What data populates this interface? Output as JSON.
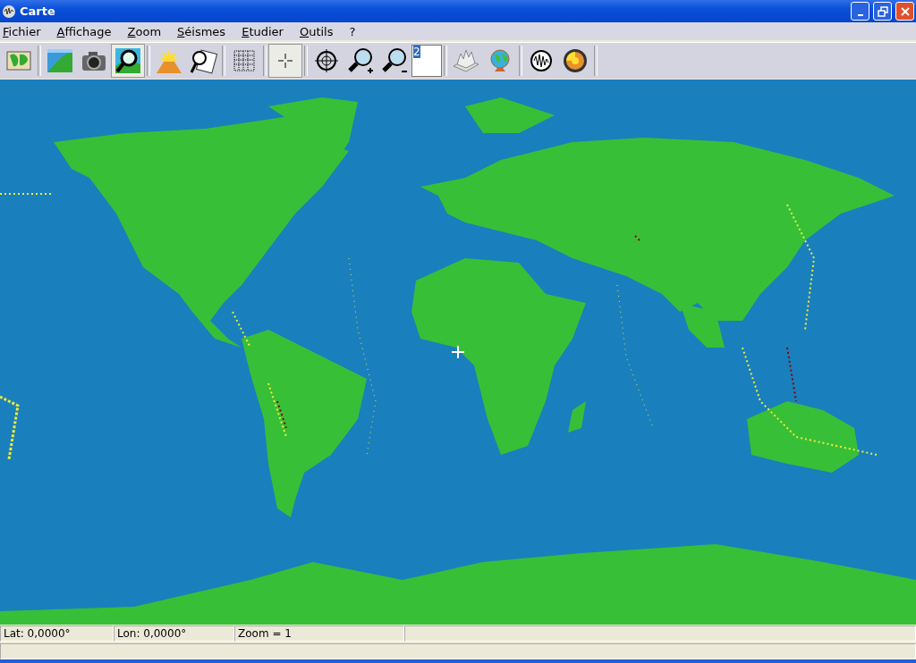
{
  "window": {
    "title": "Carte"
  },
  "menu": [
    "Fichier",
    "Affichage",
    "Zoom",
    "Séismes",
    "Etudier",
    "Outils",
    "?"
  ],
  "toolbar": [
    {
      "kind": "button",
      "selected": false
    },
    {
      "kind": "separator"
    },
    {
      "kind": "button",
      "selected": false
    },
    {
      "kind": "button",
      "selected": false
    },
    {
      "kind": "button",
      "selected": true
    },
    {
      "kind": "separator"
    },
    {
      "kind": "button",
      "selected": false
    },
    {
      "kind": "button",
      "selected": false
    },
    {
      "kind": "separator"
    },
    {
      "kind": "button",
      "selected": false
    },
    {
      "kind": "separator"
    },
    {
      "kind": "button",
      "selected": true
    },
    {
      "kind": "separator"
    },
    {
      "kind": "button",
      "selected": false
    },
    {
      "kind": "button",
      "selected": false
    },
    {
      "kind": "button",
      "selected": false
    },
    {
      "kind": "input",
      "value": "2"
    },
    {
      "kind": "separator"
    },
    {
      "kind": "button",
      "selected": false
    },
    {
      "kind": "button",
      "selected": false
    },
    {
      "kind": "separator"
    },
    {
      "kind": "button",
      "selected": false
    },
    {
      "kind": "button",
      "selected": false
    },
    {
      "kind": "separator"
    }
  ],
  "status_bar": [
    "Lat: 0,0000°",
    "Lon: 0,0000°",
    "Zoom = 1"
  ]
}
